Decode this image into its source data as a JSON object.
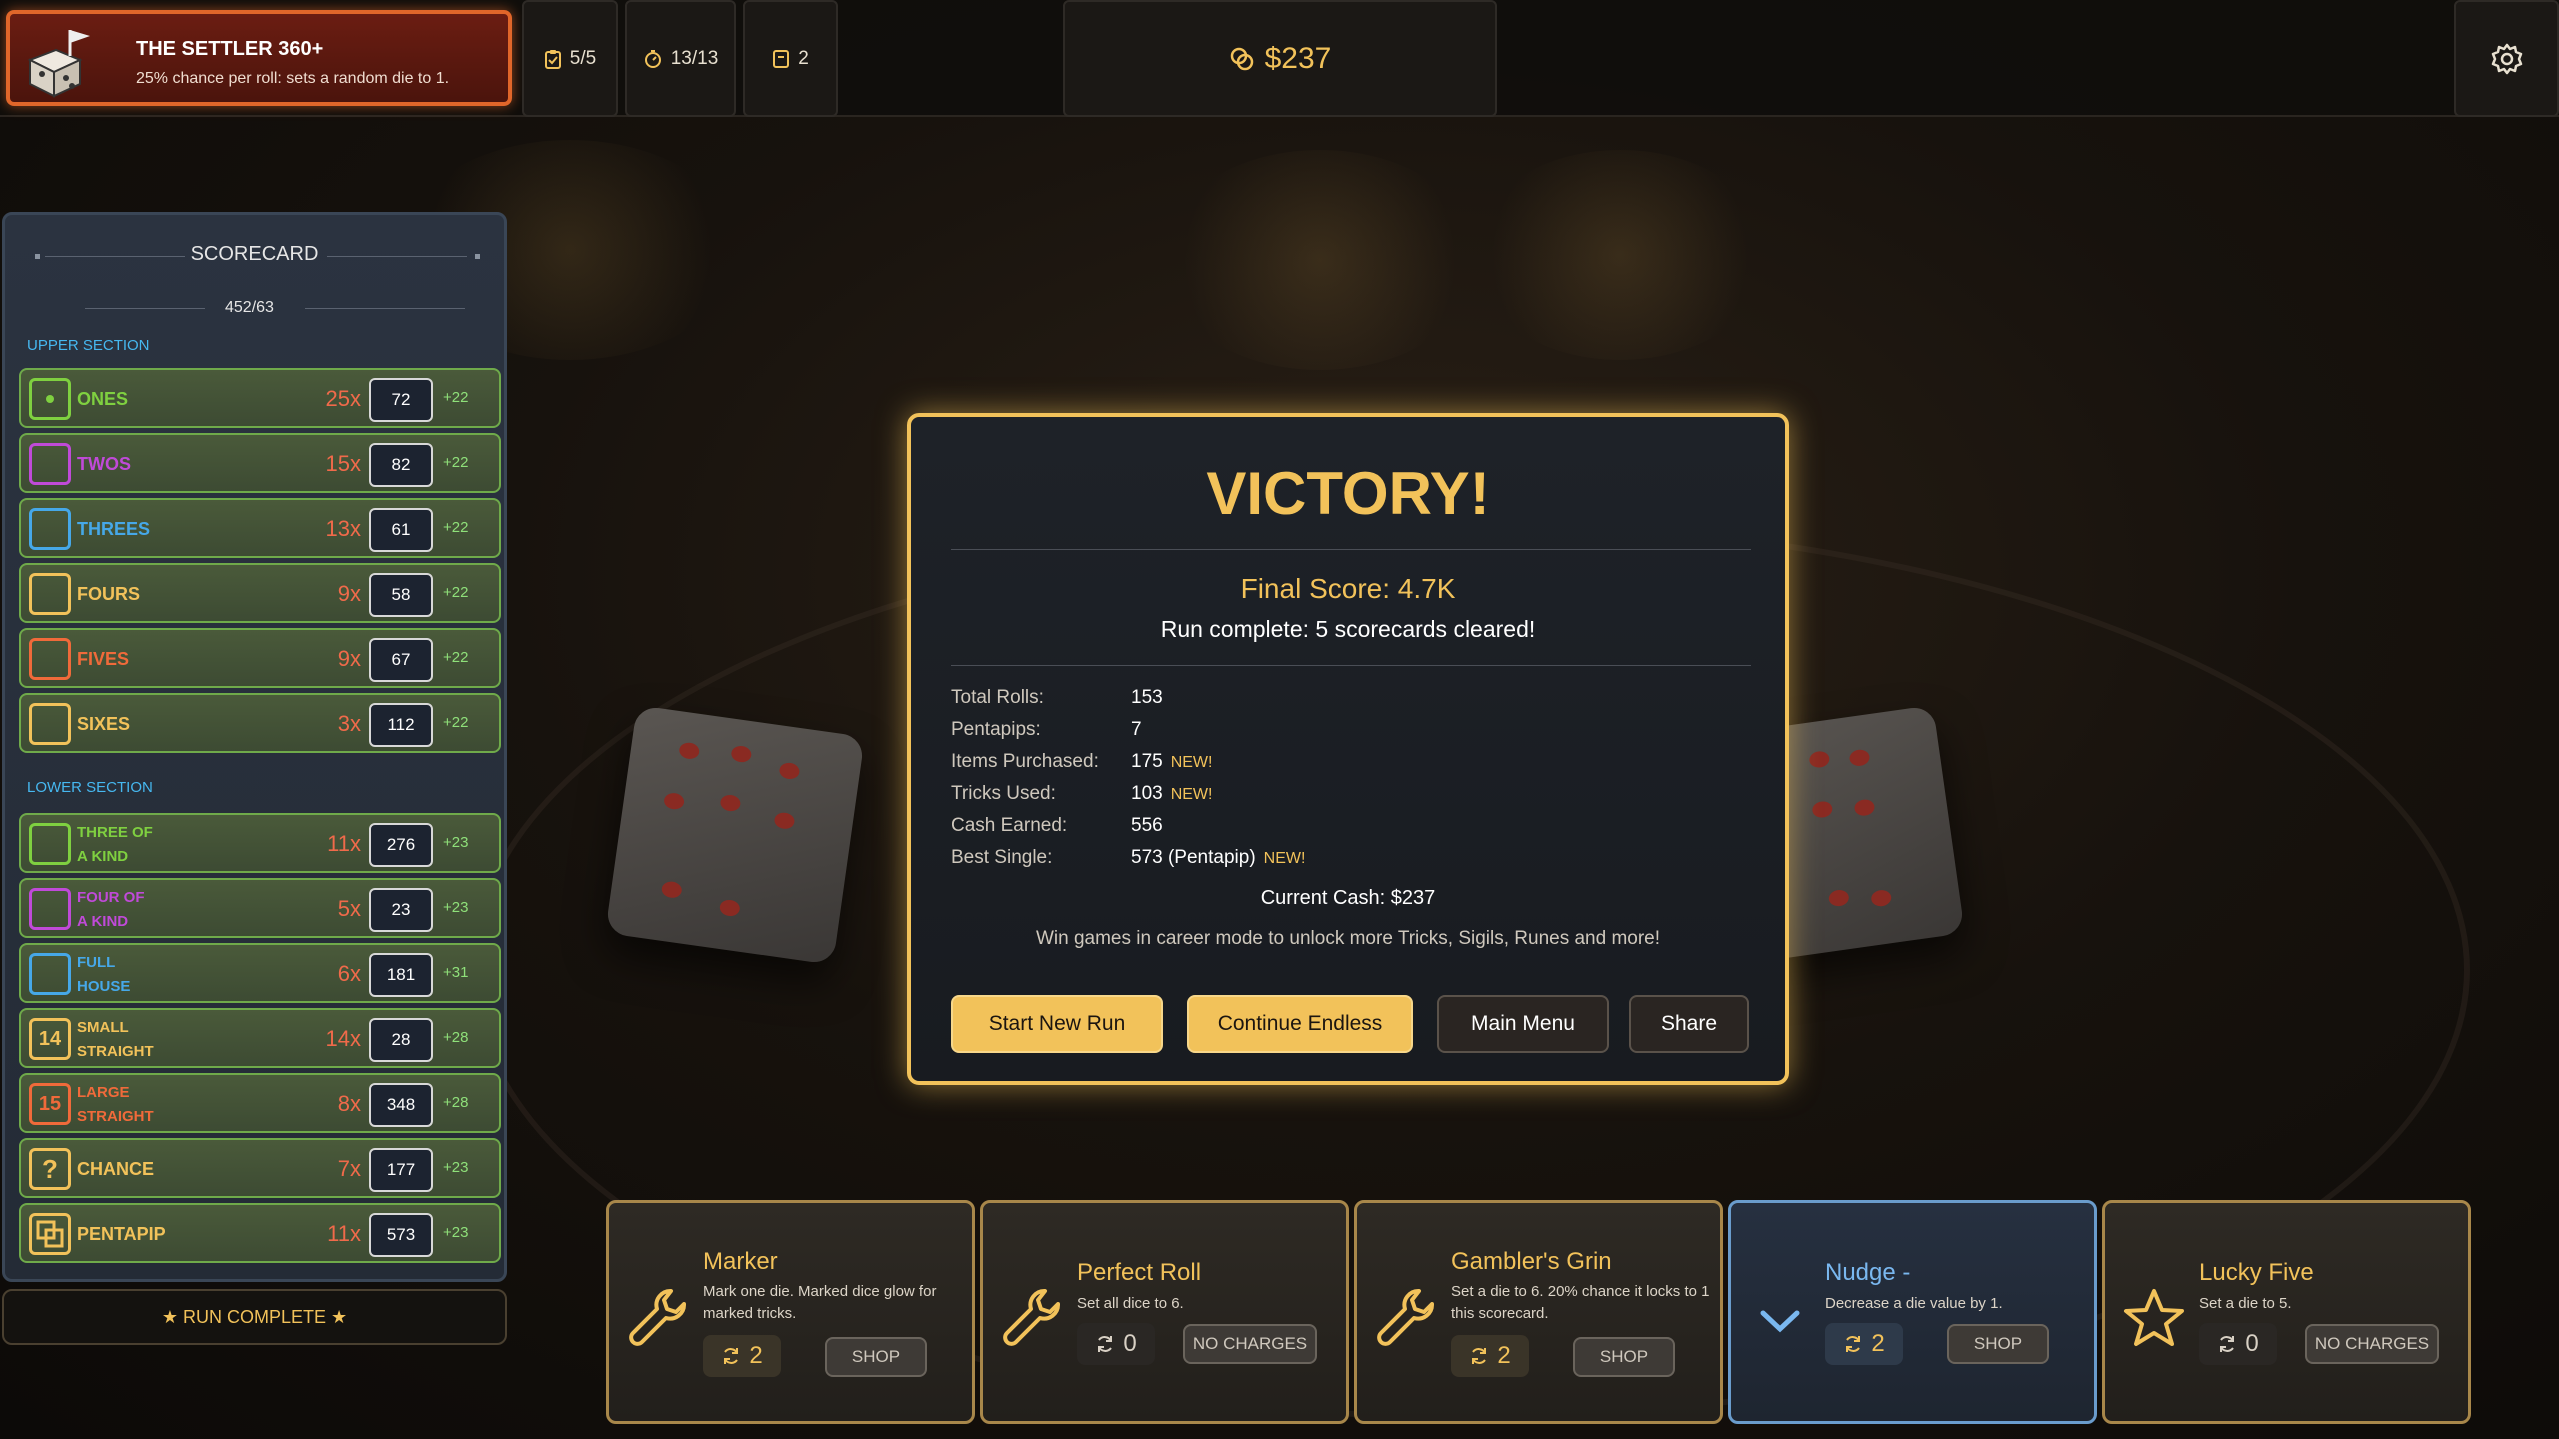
{
  "sigil": {
    "title": "THE SETTLER 360+",
    "description": "25% chance per roll: sets a random die to 1."
  },
  "stats": {
    "rolls": "5/5",
    "timer": "13/13",
    "cards": "2"
  },
  "cash": "$237",
  "scorecard": {
    "title": "SCORECARD",
    "total": "452/63",
    "upper_label": "UPPER SECTION",
    "lower_label": "LOWER SECTION",
    "upper": [
      {
        "name": "ONES",
        "mult": "25x",
        "score": "72",
        "bonus": "+22",
        "color": "#7fd040"
      },
      {
        "name": "TWOS",
        "mult": "15x",
        "score": "82",
        "bonus": "+22",
        "color": "#c04ad8"
      },
      {
        "name": "THREES",
        "mult": "13x",
        "score": "61",
        "bonus": "+22",
        "color": "#46a8e8"
      },
      {
        "name": "FOURS",
        "mult": "9x",
        "score": "58",
        "bonus": "+22",
        "color": "#f2c25a"
      },
      {
        "name": "FIVES",
        "mult": "9x",
        "score": "67",
        "bonus": "+22",
        "color": "#f06a3a"
      },
      {
        "name": "SIXES",
        "mult": "3x",
        "score": "112",
        "bonus": "+22",
        "color": "#f2c25a"
      }
    ],
    "lower": [
      {
        "name1": "THREE OF",
        "name2": "A KIND",
        "mult": "11x",
        "score": "276",
        "bonus": "+23",
        "color": "#7fd040"
      },
      {
        "name1": "FOUR OF",
        "name2": "A KIND",
        "mult": "5x",
        "score": "23",
        "bonus": "+23",
        "color": "#c04ad8"
      },
      {
        "name1": "FULL",
        "name2": "HOUSE",
        "mult": "6x",
        "score": "181",
        "bonus": "+31",
        "color": "#46a8e8"
      },
      {
        "name1": "SMALL",
        "name2": "STRAIGHT",
        "mult": "14x",
        "score": "28",
        "bonus": "+28",
        "color": "#f2c25a"
      },
      {
        "name1": "LARGE",
        "name2": "STRAIGHT",
        "mult": "8x",
        "score": "348",
        "bonus": "+28",
        "color": "#f06a3a"
      },
      {
        "name": "CHANCE",
        "mult": "7x",
        "score": "177",
        "bonus": "+23",
        "color": "#f2c25a"
      },
      {
        "name": "PENTAPIP",
        "mult": "11x",
        "score": "573",
        "bonus": "+23",
        "color": "#f2c25a"
      }
    ],
    "icon_glyphs": {
      "small": "14",
      "large": "15",
      "chance": "?"
    },
    "run_complete": "★ RUN COMPLETE ★"
  },
  "modal": {
    "title": "VICTORY!",
    "final_score": "Final Score: 4.7K",
    "subtitle": "Run complete: 5 scorecards cleared!",
    "stats": [
      {
        "label": "Total Rolls:",
        "value": "153",
        "new": ""
      },
      {
        "label": "Pentapips:",
        "value": "7",
        "new": ""
      },
      {
        "label": "Items Purchased:",
        "value": "175",
        "new": "NEW!"
      },
      {
        "label": "Tricks Used:",
        "value": "103",
        "new": "NEW!"
      },
      {
        "label": "Cash Earned:",
        "value": "556",
        "new": ""
      },
      {
        "label": "Best Single:",
        "value": "573 (Pentapip)",
        "new": "NEW!"
      }
    ],
    "current_cash": "Current Cash: $237",
    "note": "Win games in career mode to unlock more Tricks, Sigils, Runes and more!",
    "buttons": {
      "start": "Start New Run",
      "continue": "Continue Endless",
      "menu": "Main Menu",
      "share": "Share"
    }
  },
  "tricks": [
    {
      "name": "Marker",
      "desc": "Mark one die. Marked dice glow for marked tricks.",
      "charges": "2",
      "button": "SHOP"
    },
    {
      "name": "Perfect Roll",
      "desc": "Set all dice to 6.",
      "charges": "0",
      "button": "NO CHARGES"
    },
    {
      "name": "Gambler's Grin",
      "desc": "Set a die to 6. 20% chance it locks to 1 this scorecard.",
      "charges": "2",
      "button": "SHOP"
    },
    {
      "name": "Nudge -",
      "desc": "Decrease a die value by 1.",
      "charges": "2",
      "button": "SHOP"
    },
    {
      "name": "Lucky Five",
      "desc": "Set a die to 5.",
      "charges": "0",
      "button": "NO CHARGES"
    }
  ]
}
